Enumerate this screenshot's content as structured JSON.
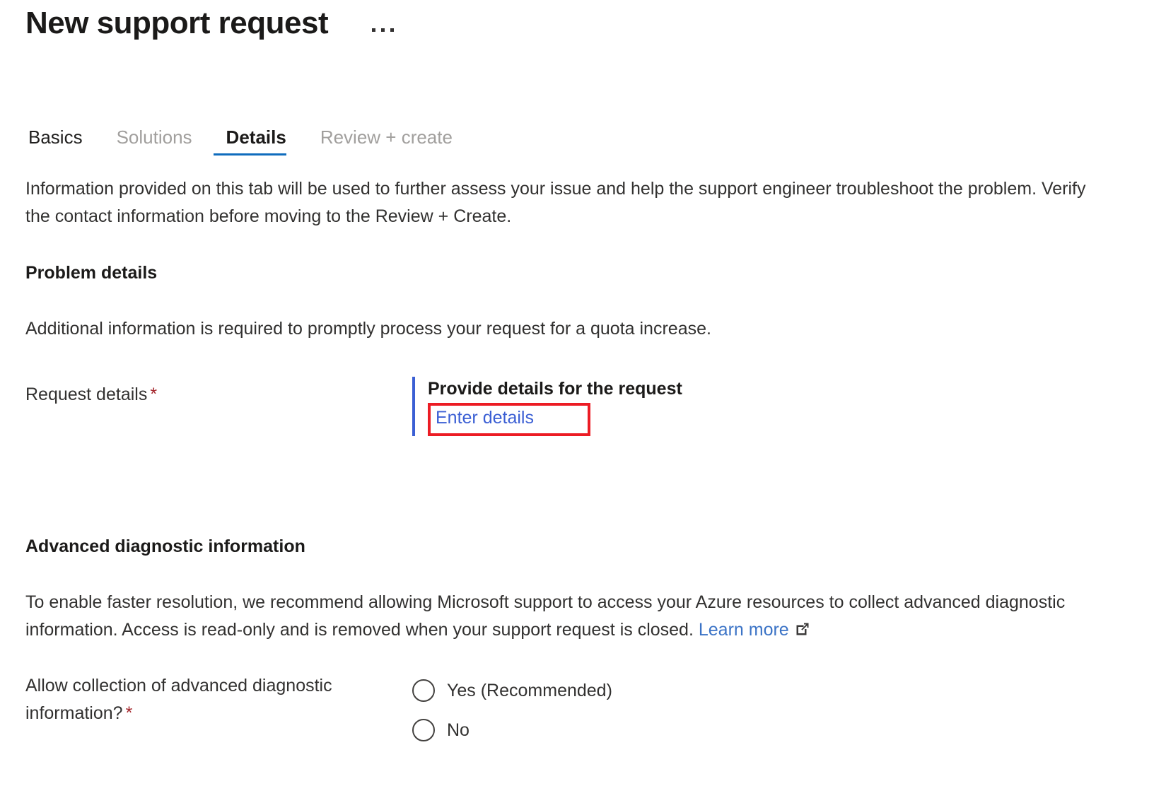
{
  "header": {
    "title": "New support request",
    "more_icon": "ellipsis-icon"
  },
  "tabs": [
    {
      "label": "Basics",
      "state": "enabled"
    },
    {
      "label": "Solutions",
      "state": "disabled"
    },
    {
      "label": "Details",
      "state": "active"
    },
    {
      "label": "Review + create",
      "state": "disabled"
    }
  ],
  "intro": "Information provided on this tab will be used to further assess your issue and help the support engineer troubleshoot the problem. Verify the contact information before moving to the Review + Create.",
  "problem_details": {
    "heading": "Problem details",
    "description": "Additional information is required to promptly process your request for a quota increase.",
    "request_details": {
      "label": "Request details",
      "required_marker": "*",
      "control_title": "Provide details for the request",
      "link_label": "Enter details",
      "highlight_color": "#ec1c24",
      "accent_color": "#3b5fd4"
    }
  },
  "advanced_diagnostics": {
    "heading": "Advanced diagnostic information",
    "description_part1": "To enable faster resolution, we recommend allowing Microsoft support to access your Azure resources to collect advanced diagnostic information. Access is read-only and is removed when your support request is closed. ",
    "learn_more_label": "Learn more",
    "learn_more_icon": "external-link-icon",
    "question_label": "Allow collection of advanced diagnostic information?",
    "question_required_marker": "*",
    "options": [
      {
        "label": "Yes (Recommended)",
        "checked": false
      },
      {
        "label": "No",
        "checked": false
      }
    ]
  },
  "colors": {
    "accent_blue": "#0f6cbd",
    "link_blue": "#3b73c6",
    "required_red": "#a4262c",
    "highlight_red": "#ec1c24",
    "text": "#323130"
  }
}
